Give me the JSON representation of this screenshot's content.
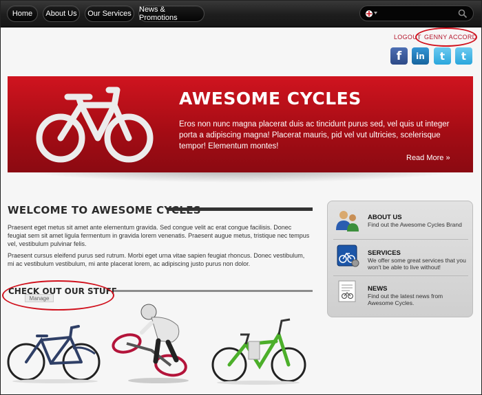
{
  "nav": {
    "items": [
      {
        "label": "Home"
      },
      {
        "label": "About Us"
      },
      {
        "label": "Our Services"
      },
      {
        "label": "News & Promotions"
      }
    ]
  },
  "search": {
    "placeholder": "",
    "value": ""
  },
  "account": {
    "logout_label": "LOGOUT",
    "separator": "|",
    "username": "GENNY ACCORD"
  },
  "social": {
    "facebook": "f",
    "linkedin": "in",
    "twitter": "t",
    "twitter2": "t"
  },
  "banner": {
    "title": "AWESOME CYCLES",
    "text": "Eros non nunc magna placerat duis ac tincidunt purus sed, vel quis ut integer porta a adipiscing magna! Placerat mauris, pid vel vut ultricies, scelerisque tempor! Elementum montes!",
    "read_more": "Read More »"
  },
  "welcome": {
    "title": "WELCOME TO AWESOME CYCLES",
    "para1": "Praesent eget metus sit amet ante elementum gravida. Sed congue velit ac erat congue facilisis. Donec feugiat sem sit amet ligula fermentum in gravida lorem venenatis. Praesent augue metus, tristique nec tempus vel, vestibulum pulvinar felis.",
    "para2": "Praesent cursus eleifend purus sed rutrum. Morbi eget urna vitae sapien feugiat rhoncus. Donec vestibulum, mi ac vestibulum vestibulum, mi ante placerat lorem, ac adipiscing justo purus non dolor."
  },
  "stuff": {
    "title": "CHECK OUT OUR STUFF",
    "manage_label": "Manage"
  },
  "sidebox": {
    "items": [
      {
        "title": "ABOUT US",
        "desc": "Find out the Awesome Cycles Brand"
      },
      {
        "title": "SERVICES",
        "desc": "We offer some great services that you won't be able to live without!"
      },
      {
        "title": "NEWS",
        "desc": "Find out the latest news from Awesome Cycles."
      }
    ]
  },
  "colors": {
    "brand_red": "#c8101c",
    "annotation_red": "#d0101c",
    "nav_bg": "#1e1e1e",
    "facebook": "#3b5998",
    "linkedin": "#1f7bbf",
    "twitter": "#33b3e6"
  }
}
